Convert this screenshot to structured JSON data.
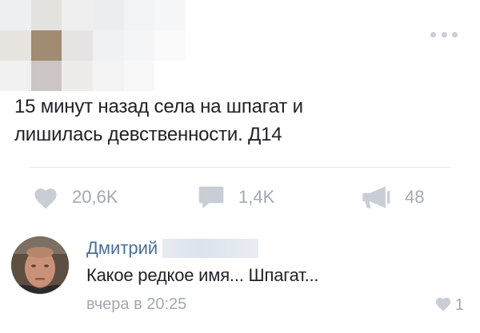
{
  "post": {
    "text_line1": "15 минут назад села на шпагат и",
    "text_line2": "лишилась девственности. Д14",
    "likes": "20,6K",
    "comments": "1,4K",
    "shares": "48",
    "more_icon": "more-horizontal-icon",
    "like_icon": "heart-icon",
    "comment_icon": "comment-bubble-icon",
    "share_icon": "megaphone-icon"
  },
  "comment": {
    "author": "Дмитрий",
    "text": "Какое редкое имя... Шпагат...",
    "time": "вчера в 20:25",
    "likes": "1",
    "like_icon": "heart-icon"
  },
  "colors": {
    "icon_gray": "#c9ced6",
    "count_gray": "#a3a9b2",
    "link_blue": "#4a6f98",
    "text": "#1f2126"
  }
}
